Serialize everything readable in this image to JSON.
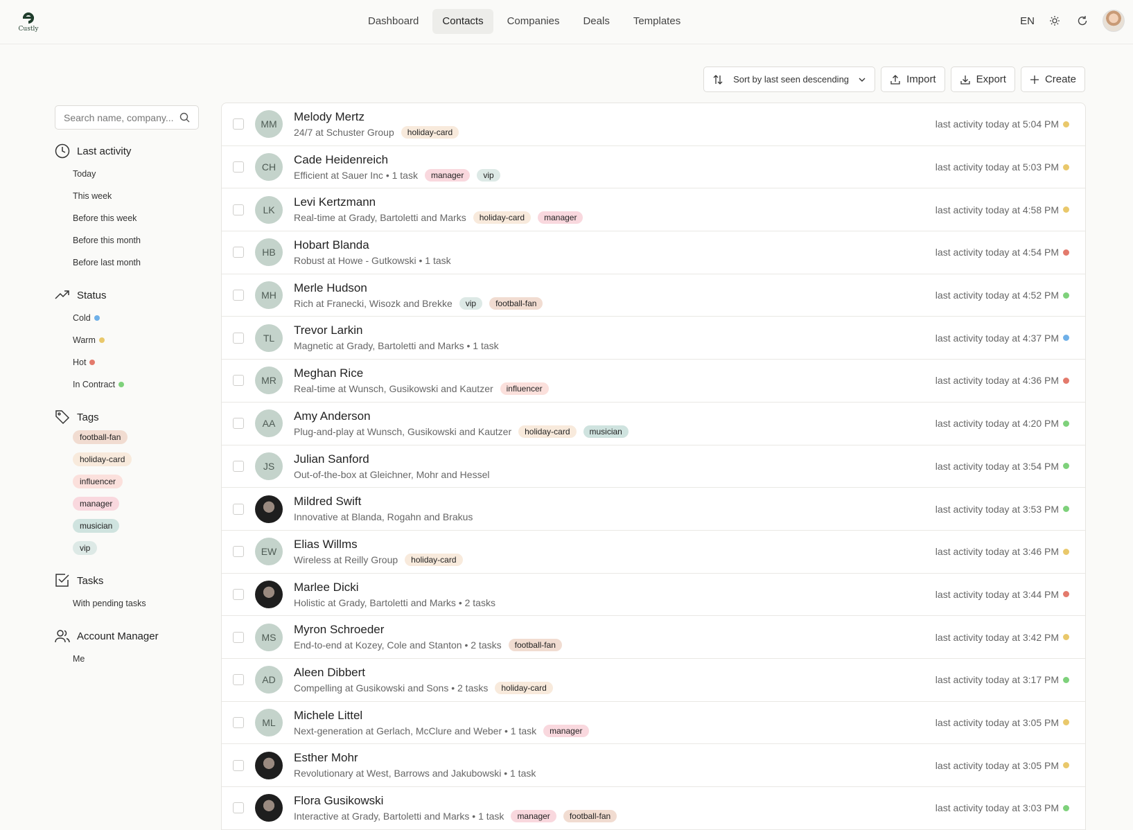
{
  "app": {
    "logo_text": "Custly"
  },
  "nav": [
    {
      "label": "Dashboard",
      "active": false
    },
    {
      "label": "Contacts",
      "active": true
    },
    {
      "label": "Companies",
      "active": false
    },
    {
      "label": "Deals",
      "active": false
    },
    {
      "label": "Templates",
      "active": false
    }
  ],
  "topbar": {
    "language": "EN",
    "icons": [
      "sun-icon",
      "refresh-icon"
    ]
  },
  "toolbar": {
    "sort_label": "Sort by last seen descending",
    "import_label": "Import",
    "export_label": "Export",
    "create_label": "Create"
  },
  "sidebar": {
    "search_placeholder": "Search name, company...",
    "last_activity": {
      "title": "Last activity",
      "items": [
        "Today",
        "This week",
        "Before this week",
        "Before this month",
        "Before last month"
      ]
    },
    "status": {
      "title": "Status",
      "items": [
        {
          "label": "Cold",
          "color": "#6fb0e8"
        },
        {
          "label": "Warm",
          "color": "#e9c86b"
        },
        {
          "label": "Hot",
          "color": "#e37a6c"
        },
        {
          "label": "In Contract",
          "color": "#7ed17b"
        }
      ]
    },
    "tags": {
      "title": "Tags",
      "items": [
        "football-fan",
        "holiday-card",
        "influencer",
        "manager",
        "musician",
        "vip"
      ]
    },
    "tasks": {
      "title": "Tasks",
      "items": [
        "With pending tasks"
      ]
    },
    "account_manager": {
      "title": "Account Manager",
      "items": [
        "Me"
      ]
    }
  },
  "tag_colors": {
    "football-fan": "#f1dcd1",
    "holiday-card": "#f8eadc",
    "influencer": "#fbe0dc",
    "manager": "#f9d8de",
    "musician": "#cfe3df",
    "vip": "#dde9e6"
  },
  "status_colors": {
    "Cold": "#6fb0e8",
    "Warm": "#e9c86b",
    "Hot": "#e37a6c",
    "In Contract": "#7ed17b"
  },
  "contacts": [
    {
      "initials": "MM",
      "name": "Melody Mertz",
      "desc": "24/7 at Schuster Group",
      "tags": [
        "holiday-card"
      ],
      "activity": "last activity today at 5:04 PM",
      "status": "Warm"
    },
    {
      "initials": "CH",
      "name": "Cade Heidenreich",
      "desc": "Efficient at Sauer Inc • 1 task",
      "tags": [
        "manager",
        "vip"
      ],
      "activity": "last activity today at 5:03 PM",
      "status": "Warm"
    },
    {
      "initials": "LK",
      "name": "Levi Kertzmann",
      "desc": "Real-time at Grady, Bartoletti and Marks",
      "tags": [
        "holiday-card",
        "manager"
      ],
      "activity": "last activity today at 4:58 PM",
      "status": "Warm"
    },
    {
      "initials": "HB",
      "name": "Hobart Blanda",
      "desc": "Robust at Howe - Gutkowski • 1 task",
      "tags": [],
      "activity": "last activity today at 4:54 PM",
      "status": "Hot"
    },
    {
      "initials": "MH",
      "name": "Merle Hudson",
      "desc": "Rich at Franecki, Wisozk and Brekke",
      "tags": [
        "vip",
        "football-fan"
      ],
      "activity": "last activity today at 4:52 PM",
      "status": "In Contract"
    },
    {
      "initials": "TL",
      "name": "Trevor Larkin",
      "desc": "Magnetic at Grady, Bartoletti and Marks • 1 task",
      "tags": [],
      "activity": "last activity today at 4:37 PM",
      "status": "Cold"
    },
    {
      "initials": "MR",
      "name": "Meghan Rice",
      "desc": "Real-time at Wunsch, Gusikowski and Kautzer",
      "tags": [
        "influencer"
      ],
      "activity": "last activity today at 4:36 PM",
      "status": "Hot"
    },
    {
      "initials": "AA",
      "name": "Amy Anderson",
      "desc": "Plug-and-play at Wunsch, Gusikowski and Kautzer",
      "tags": [
        "holiday-card",
        "musician"
      ],
      "activity": "last activity today at 4:20 PM",
      "status": "In Contract"
    },
    {
      "initials": "JS",
      "name": "Julian Sanford",
      "desc": "Out-of-the-box at Gleichner, Mohr and Hessel",
      "tags": [],
      "activity": "last activity today at 3:54 PM",
      "status": "In Contract"
    },
    {
      "initials": "",
      "photo": true,
      "name": "Mildred Swift",
      "desc": "Innovative at Blanda, Rogahn and Brakus",
      "tags": [],
      "activity": "last activity today at 3:53 PM",
      "status": "In Contract"
    },
    {
      "initials": "EW",
      "name": "Elias Willms",
      "desc": "Wireless at Reilly Group",
      "tags": [
        "holiday-card"
      ],
      "activity": "last activity today at 3:46 PM",
      "status": "Warm"
    },
    {
      "initials": "",
      "photo": true,
      "name": "Marlee Dicki",
      "desc": "Holistic at Grady, Bartoletti and Marks • 2 tasks",
      "tags": [],
      "activity": "last activity today at 3:44 PM",
      "status": "Hot"
    },
    {
      "initials": "MS",
      "name": "Myron Schroeder",
      "desc": "End-to-end at Kozey, Cole and Stanton • 2 tasks",
      "tags": [
        "football-fan"
      ],
      "activity": "last activity today at 3:42 PM",
      "status": "Warm"
    },
    {
      "initials": "AD",
      "name": "Aleen Dibbert",
      "desc": "Compelling at Gusikowski and Sons • 2 tasks",
      "tags": [
        "holiday-card"
      ],
      "activity": "last activity today at 3:17 PM",
      "status": "In Contract"
    },
    {
      "initials": "ML",
      "name": "Michele Littel",
      "desc": "Next-generation at Gerlach, McClure and Weber • 1 task",
      "tags": [
        "manager"
      ],
      "activity": "last activity today at 3:05 PM",
      "status": "Warm"
    },
    {
      "initials": "",
      "photo": true,
      "name": "Esther Mohr",
      "desc": "Revolutionary at West, Barrows and Jakubowski • 1 task",
      "tags": [],
      "activity": "last activity today at 3:05 PM",
      "status": "Warm"
    },
    {
      "initials": "",
      "photo": true,
      "name": "Flora Gusikowski",
      "desc": "Interactive at Grady, Bartoletti and Marks • 1 task",
      "tags": [
        "manager",
        "football-fan"
      ],
      "activity": "last activity today at 3:03 PM",
      "status": "In Contract"
    }
  ]
}
